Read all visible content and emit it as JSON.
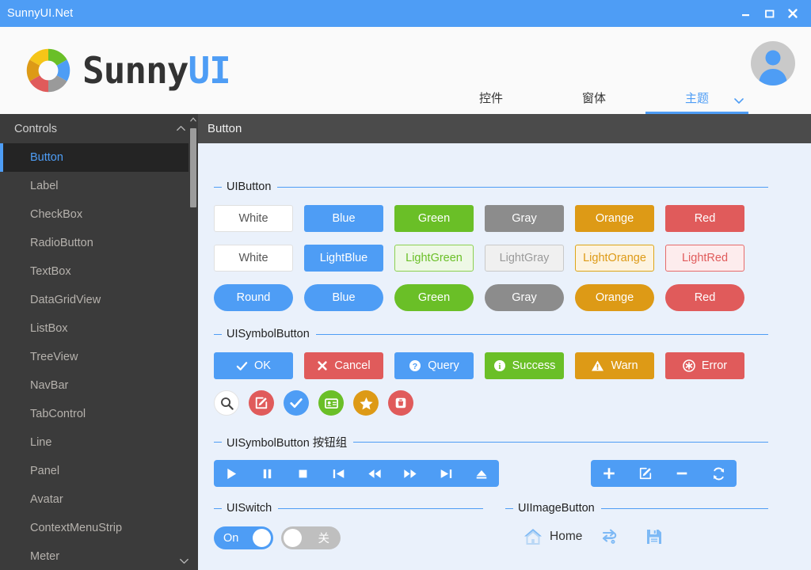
{
  "window": {
    "title": "SunnyUI.Net",
    "minimize_label": "minimize",
    "maximize_label": "maximize",
    "close_label": "close"
  },
  "header": {
    "logo_text_main": "Sunny",
    "logo_text_accent": "UI",
    "nav": [
      {
        "label": "控件",
        "active": false
      },
      {
        "label": "窗体",
        "active": false
      },
      {
        "label": "主题",
        "active": true
      }
    ]
  },
  "sidebar": {
    "header_label": "Controls",
    "items": [
      {
        "label": "Button",
        "active": true
      },
      {
        "label": "Label",
        "active": false
      },
      {
        "label": "CheckBox",
        "active": false
      },
      {
        "label": "RadioButton",
        "active": false
      },
      {
        "label": "TextBox",
        "active": false
      },
      {
        "label": "DataGridView",
        "active": false
      },
      {
        "label": "ListBox",
        "active": false
      },
      {
        "label": "TreeView",
        "active": false
      },
      {
        "label": "NavBar",
        "active": false
      },
      {
        "label": "TabControl",
        "active": false
      },
      {
        "label": "Line",
        "active": false
      },
      {
        "label": "Panel",
        "active": false
      },
      {
        "label": "Avatar",
        "active": false
      },
      {
        "label": "ContextMenuStrip",
        "active": false
      },
      {
        "label": "Meter",
        "active": false
      }
    ]
  },
  "content": {
    "title": "Button",
    "groups": {
      "uibutton": {
        "title": "UIButton",
        "row1": [
          {
            "label": "White",
            "style": "white"
          },
          {
            "label": "Blue",
            "style": "blue"
          },
          {
            "label": "Green",
            "style": "green"
          },
          {
            "label": "Gray",
            "style": "gray"
          },
          {
            "label": "Orange",
            "style": "orange"
          },
          {
            "label": "Red",
            "style": "red"
          }
        ],
        "row2": [
          {
            "label": "White",
            "style": "white"
          },
          {
            "label": "LightBlue",
            "style": "lightblue"
          },
          {
            "label": "LightGreen",
            "style": "lightgreen"
          },
          {
            "label": "LightGray",
            "style": "lightgray"
          },
          {
            "label": "LightOrange",
            "style": "lightorange"
          },
          {
            "label": "LightRed",
            "style": "lightred"
          }
        ],
        "row3": [
          {
            "label": "Round",
            "style": "blue"
          },
          {
            "label": "Blue",
            "style": "blue"
          },
          {
            "label": "Green",
            "style": "green"
          },
          {
            "label": "Gray",
            "style": "gray"
          },
          {
            "label": "Orange",
            "style": "orange"
          },
          {
            "label": "Red",
            "style": "red"
          }
        ]
      },
      "uisymbolbutton": {
        "title": "UISymbolButton",
        "buttons": [
          {
            "label": "OK",
            "icon": "check-icon",
            "style": "blue"
          },
          {
            "label": "Cancel",
            "icon": "cross-icon",
            "style": "red"
          },
          {
            "label": "Query",
            "icon": "question-circle-icon",
            "style": "blue"
          },
          {
            "label": "Success",
            "icon": "info-circle-icon",
            "style": "green"
          },
          {
            "label": "Warn",
            "icon": "warning-triangle-icon",
            "style": "orange"
          },
          {
            "label": "Error",
            "icon": "error-circle-icon",
            "style": "red"
          }
        ],
        "icon_buttons": [
          {
            "icon": "search-icon",
            "style": "white"
          },
          {
            "icon": "edit-square-icon",
            "style": "red"
          },
          {
            "icon": "check-icon",
            "style": "blue"
          },
          {
            "icon": "id-card-icon",
            "style": "green"
          },
          {
            "icon": "star-icon",
            "style": "orange"
          },
          {
            "icon": "trash-icon",
            "style": "red"
          }
        ]
      },
      "uisymbolbutton_group": {
        "title": "UISymbolButton 按钮组",
        "media_buttons": [
          {
            "icon": "play-icon"
          },
          {
            "icon": "pause-icon"
          },
          {
            "icon": "stop-icon"
          },
          {
            "icon": "skip-backward-icon"
          },
          {
            "icon": "rewind-icon"
          },
          {
            "icon": "fast-forward-icon"
          },
          {
            "icon": "skip-forward-icon"
          },
          {
            "icon": "eject-icon"
          }
        ],
        "action_buttons": [
          {
            "icon": "plus-icon"
          },
          {
            "icon": "edit-square-icon"
          },
          {
            "icon": "minus-icon"
          },
          {
            "icon": "refresh-icon"
          }
        ]
      },
      "uiswitch": {
        "title": "UISwitch",
        "switches": [
          {
            "label": "On",
            "state": "on"
          },
          {
            "label": "关",
            "state": "off"
          }
        ]
      },
      "uiimagebutton": {
        "title": "UIImageButton",
        "buttons": [
          {
            "icon": "home-icon",
            "label": "Home"
          },
          {
            "icon": "exchange-icon",
            "label": ""
          },
          {
            "icon": "save-floppy-icon",
            "label": ""
          }
        ]
      }
    }
  },
  "colors": {
    "accent_blue": "#4e9df5",
    "green": "#6abf27",
    "gray": "#8c8c8c",
    "orange": "#dd9a16",
    "red": "#e05b5b",
    "content_bg": "#eaf1fb",
    "sidebar_bg": "#3b3b3b"
  }
}
